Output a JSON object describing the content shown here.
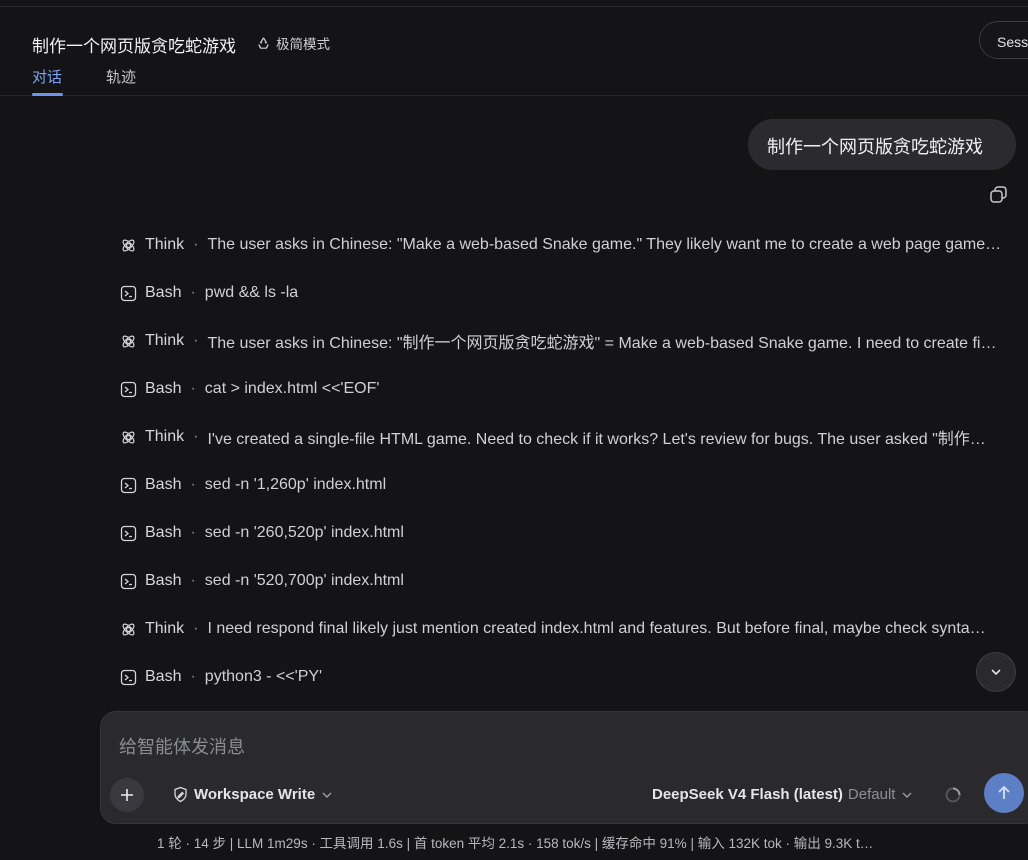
{
  "header": {
    "title": "制作一个网页版贪吃蛇游戏",
    "mode_label": "极简模式",
    "session_button": "Sess",
    "tabs": [
      {
        "label": "对话",
        "active": true
      },
      {
        "label": "轨迹",
        "active": false
      }
    ]
  },
  "conversation": {
    "user_message": "制作一个网页版贪吃蛇游戏",
    "steps": [
      {
        "kind": "Think",
        "icon": "think-icon",
        "text": "The user asks in Chinese: \"Make a web-based Snake game.\" They likely want me to create a web page game…"
      },
      {
        "kind": "Bash",
        "icon": "terminal-icon",
        "text": "pwd && ls -la"
      },
      {
        "kind": "Think",
        "icon": "think-icon",
        "text": "The user asks in Chinese: \"制作一个网页版贪吃蛇游戏\" = Make a web-based Snake game. I need to create fi…"
      },
      {
        "kind": "Bash",
        "icon": "terminal-icon",
        "text": "cat > index.html <<'EOF'"
      },
      {
        "kind": "Think",
        "icon": "think-icon",
        "text": "I've created a single-file HTML game. Need to check if it works? Let's review for bugs. The user asked \"制作…"
      },
      {
        "kind": "Bash",
        "icon": "terminal-icon",
        "text": "sed -n '1,260p' index.html"
      },
      {
        "kind": "Bash",
        "icon": "terminal-icon",
        "text": "sed -n '260,520p' index.html"
      },
      {
        "kind": "Bash",
        "icon": "terminal-icon",
        "text": "sed -n '520,700p' index.html"
      },
      {
        "kind": "Think",
        "icon": "think-icon",
        "text": "I need respond final likely just mention created index.html and features. But before final, maybe check synta…"
      },
      {
        "kind": "Bash",
        "icon": "terminal-icon",
        "text": "python3 - <<'PY'"
      }
    ],
    "separator": "·"
  },
  "composer": {
    "placeholder": "给智能体发消息",
    "permission": "Workspace Write",
    "model_name": "DeepSeek V4 Flash (latest)",
    "model_variant": "Default"
  },
  "status_bar": "1 轮 · 14 步   |   LLM 1m29s · 工具调用 1.6s   |   首 token 平均 2.1s · 158 tok/s   |   缓存命中 91%   |   输入 132K tok · 输出 9.3K t…",
  "colors": {
    "background": "#141416",
    "accent": "#6d95f0",
    "bubble": "#2b2b2f",
    "send_button": "#5d7fc6"
  }
}
